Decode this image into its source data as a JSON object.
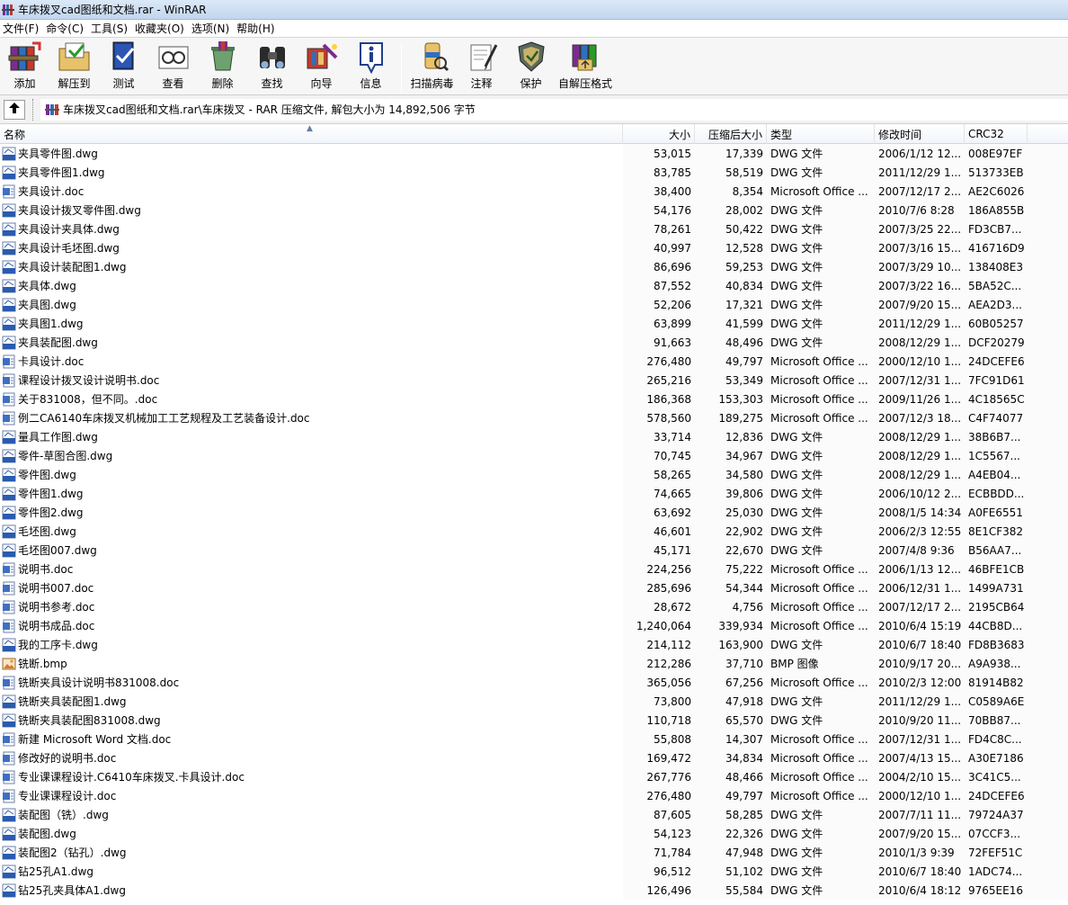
{
  "window": {
    "title": "车床拨叉cad图纸和文档.rar - WinRAR"
  },
  "menu": [
    "文件(F)",
    "命令(C)",
    "工具(S)",
    "收藏夹(O)",
    "选项(N)",
    "帮助(H)"
  ],
  "toolbar": {
    "group1": [
      {
        "label": "添加",
        "icon": "add-books-icon"
      },
      {
        "label": "解压到",
        "icon": "extract-folder-icon"
      },
      {
        "label": "测试",
        "icon": "test-book-icon"
      },
      {
        "label": "查看",
        "icon": "view-glasses-icon"
      },
      {
        "label": "删除",
        "icon": "delete-bin-icon"
      },
      {
        "label": "查找",
        "icon": "find-binoculars-icon"
      },
      {
        "label": "向导",
        "icon": "wizard-icon"
      },
      {
        "label": "信息",
        "icon": "info-icon"
      }
    ],
    "group2": [
      {
        "label": "扫描病毒",
        "icon": "virus-scan-icon"
      },
      {
        "label": "注释",
        "icon": "comment-icon"
      },
      {
        "label": "保护",
        "icon": "protect-shield-icon"
      },
      {
        "label": "自解压格式",
        "icon": "sfx-archive-icon"
      }
    ]
  },
  "address": {
    "path": "车床拨叉cad图纸和文档.rar\\车床拨叉 - RAR 压缩文件, 解包大小为 14,892,506 字节"
  },
  "columns": {
    "name": "名称",
    "size": "大小",
    "packed": "压缩后大小",
    "type": "类型",
    "modified": "修改时间",
    "crc": "CRC32"
  },
  "colors": {
    "dwg_icon": "#2a5bb0",
    "doc_icon": "#3f6fc2",
    "bmp_icon": "#d9782a",
    "titlebar": "#c2d6ee"
  },
  "files": [
    {
      "name": "夹具零件图.dwg",
      "kind": "dwg",
      "size": "53,015",
      "packed": "17,339",
      "type": "DWG 文件",
      "modified": "2006/1/12 12...",
      "crc": "008E97EF"
    },
    {
      "name": "夹具零件图1.dwg",
      "kind": "dwg",
      "size": "83,785",
      "packed": "58,519",
      "type": "DWG 文件",
      "modified": "2011/12/29 1...",
      "crc": "513733EB"
    },
    {
      "name": "夹具设计.doc",
      "kind": "doc",
      "size": "38,400",
      "packed": "8,354",
      "type": "Microsoft Office ...",
      "modified": "2007/12/17 2...",
      "crc": "AE2C6026"
    },
    {
      "name": "夹具设计拨叉零件图.dwg",
      "kind": "dwg",
      "size": "54,176",
      "packed": "28,002",
      "type": "DWG 文件",
      "modified": "2010/7/6 8:28",
      "crc": "186A855B"
    },
    {
      "name": "夹具设计夹具体.dwg",
      "kind": "dwg",
      "size": "78,261",
      "packed": "50,422",
      "type": "DWG 文件",
      "modified": "2007/3/25 22...",
      "crc": "FD3CB7..."
    },
    {
      "name": "夹具设计毛坯图.dwg",
      "kind": "dwg",
      "size": "40,997",
      "packed": "12,528",
      "type": "DWG 文件",
      "modified": "2007/3/16 15...",
      "crc": "416716D9"
    },
    {
      "name": "夹具设计装配图1.dwg",
      "kind": "dwg",
      "size": "86,696",
      "packed": "59,253",
      "type": "DWG 文件",
      "modified": "2007/3/29 10...",
      "crc": "138408E3"
    },
    {
      "name": "夹具体.dwg",
      "kind": "dwg",
      "size": "87,552",
      "packed": "40,834",
      "type": "DWG 文件",
      "modified": "2007/3/22 16...",
      "crc": "5BA52C..."
    },
    {
      "name": "夹具图.dwg",
      "kind": "dwg",
      "size": "52,206",
      "packed": "17,321",
      "type": "DWG 文件",
      "modified": "2007/9/20 15...",
      "crc": "AEA2D3..."
    },
    {
      "name": "夹具图1.dwg",
      "kind": "dwg",
      "size": "63,899",
      "packed": "41,599",
      "type": "DWG 文件",
      "modified": "2011/12/29 1...",
      "crc": "60B05257"
    },
    {
      "name": "夹具装配图.dwg",
      "kind": "dwg",
      "size": "91,663",
      "packed": "48,496",
      "type": "DWG 文件",
      "modified": "2008/12/29 1...",
      "crc": "DCF20279"
    },
    {
      "name": "卡具设计.doc",
      "kind": "doc",
      "size": "276,480",
      "packed": "49,797",
      "type": "Microsoft Office ...",
      "modified": "2000/12/10 1...",
      "crc": "24DCEFE6"
    },
    {
      "name": "课程设计拨叉设计说明书.doc",
      "kind": "doc",
      "size": "265,216",
      "packed": "53,349",
      "type": "Microsoft Office ...",
      "modified": "2007/12/31 1...",
      "crc": "7FC91D61"
    },
    {
      "name": "关于831008，但不同。.doc",
      "kind": "doc",
      "size": "186,368",
      "packed": "153,303",
      "type": "Microsoft Office ...",
      "modified": "2009/11/26 1...",
      "crc": "4C18565C"
    },
    {
      "name": "例二CA6140车床拨叉机械加工工艺规程及工艺装备设计.doc",
      "kind": "doc",
      "size": "578,560",
      "packed": "189,275",
      "type": "Microsoft Office ...",
      "modified": "2007/12/3 18...",
      "crc": "C4F74077"
    },
    {
      "name": "量具工作图.dwg",
      "kind": "dwg",
      "size": "33,714",
      "packed": "12,836",
      "type": "DWG 文件",
      "modified": "2008/12/29 1...",
      "crc": "38B6B7..."
    },
    {
      "name": "零件-草图合图.dwg",
      "kind": "dwg",
      "size": "70,745",
      "packed": "34,967",
      "type": "DWG 文件",
      "modified": "2008/12/29 1...",
      "crc": "1C5567..."
    },
    {
      "name": "零件图.dwg",
      "kind": "dwg",
      "size": "58,265",
      "packed": "34,580",
      "type": "DWG 文件",
      "modified": "2008/12/29 1...",
      "crc": "A4EB04..."
    },
    {
      "name": "零件图1.dwg",
      "kind": "dwg",
      "size": "74,665",
      "packed": "39,806",
      "type": "DWG 文件",
      "modified": "2006/10/12 2...",
      "crc": "ECBBDD..."
    },
    {
      "name": "零件图2.dwg",
      "kind": "dwg",
      "size": "63,692",
      "packed": "25,030",
      "type": "DWG 文件",
      "modified": "2008/1/5 14:34",
      "crc": "A0FE6551"
    },
    {
      "name": "毛坯图.dwg",
      "kind": "dwg",
      "size": "46,601",
      "packed": "22,902",
      "type": "DWG 文件",
      "modified": "2006/2/3 12:55",
      "crc": "8E1CF382"
    },
    {
      "name": "毛坯图007.dwg",
      "kind": "dwg",
      "size": "45,171",
      "packed": "22,670",
      "type": "DWG 文件",
      "modified": "2007/4/8 9:36",
      "crc": "B56AA7..."
    },
    {
      "name": "说明书.doc",
      "kind": "doc",
      "size": "224,256",
      "packed": "75,222",
      "type": "Microsoft Office ...",
      "modified": "2006/1/13 12...",
      "crc": "46BFE1CB"
    },
    {
      "name": "说明书007.doc",
      "kind": "doc",
      "size": "285,696",
      "packed": "54,344",
      "type": "Microsoft Office ...",
      "modified": "2006/12/31 1...",
      "crc": "1499A731"
    },
    {
      "name": "说明书参考.doc",
      "kind": "doc",
      "size": "28,672",
      "packed": "4,756",
      "type": "Microsoft Office ...",
      "modified": "2007/12/17 2...",
      "crc": "2195CB64"
    },
    {
      "name": "说明书成品.doc",
      "kind": "doc",
      "size": "1,240,064",
      "packed": "339,934",
      "type": "Microsoft Office ...",
      "modified": "2010/6/4 15:19",
      "crc": "44CB8D..."
    },
    {
      "name": "我的工序卡.dwg",
      "kind": "dwg",
      "size": "214,112",
      "packed": "163,900",
      "type": "DWG 文件",
      "modified": "2010/6/7 18:40",
      "crc": "FD8B3683"
    },
    {
      "name": "铣断.bmp",
      "kind": "bmp",
      "size": "212,286",
      "packed": "37,710",
      "type": "BMP 图像",
      "modified": "2010/9/17 20...",
      "crc": "A9A938..."
    },
    {
      "name": "铣断夹具设计说明书831008.doc",
      "kind": "doc",
      "size": "365,056",
      "packed": "67,256",
      "type": "Microsoft Office ...",
      "modified": "2010/2/3 12:00",
      "crc": "81914B82"
    },
    {
      "name": "铣断夹具装配图1.dwg",
      "kind": "dwg",
      "size": "73,800",
      "packed": "47,918",
      "type": "DWG 文件",
      "modified": "2011/12/29 1...",
      "crc": "C0589A6E"
    },
    {
      "name": "铣断夹具装配图831008.dwg",
      "kind": "dwg",
      "size": "110,718",
      "packed": "65,570",
      "type": "DWG 文件",
      "modified": "2010/9/20 11...",
      "crc": "70BB87..."
    },
    {
      "name": "新建 Microsoft Word 文档.doc",
      "kind": "doc",
      "size": "55,808",
      "packed": "14,307",
      "type": "Microsoft Office ...",
      "modified": "2007/12/31 1...",
      "crc": "FD4C8C..."
    },
    {
      "name": "修改好的说明书.doc",
      "kind": "doc",
      "size": "169,472",
      "packed": "34,834",
      "type": "Microsoft Office ...",
      "modified": "2007/4/13 15...",
      "crc": "A30E7186"
    },
    {
      "name": "专业课课程设计.C6410车床拨叉.卡具设计.doc",
      "kind": "doc",
      "size": "267,776",
      "packed": "48,466",
      "type": "Microsoft Office ...",
      "modified": "2004/2/10 15...",
      "crc": "3C41C5..."
    },
    {
      "name": "专业课课程设计.doc",
      "kind": "doc",
      "size": "276,480",
      "packed": "49,797",
      "type": "Microsoft Office ...",
      "modified": "2000/12/10 1...",
      "crc": "24DCEFE6"
    },
    {
      "name": "装配图（铣）.dwg",
      "kind": "dwg",
      "size": "87,605",
      "packed": "58,285",
      "type": "DWG 文件",
      "modified": "2007/7/11 11...",
      "crc": "79724A37"
    },
    {
      "name": "装配图.dwg",
      "kind": "dwg",
      "size": "54,123",
      "packed": "22,326",
      "type": "DWG 文件",
      "modified": "2007/9/20 15...",
      "crc": "07CCF3..."
    },
    {
      "name": "装配图2（钻孔）.dwg",
      "kind": "dwg",
      "size": "71,784",
      "packed": "47,948",
      "type": "DWG 文件",
      "modified": "2010/1/3 9:39",
      "crc": "72FEF51C"
    },
    {
      "name": "钻25孔A1.dwg",
      "kind": "dwg",
      "size": "96,512",
      "packed": "51,102",
      "type": "DWG 文件",
      "modified": "2010/6/7 18:40",
      "crc": "1ADC74..."
    },
    {
      "name": "钻25孔夹具体A1.dwg",
      "kind": "dwg",
      "size": "126,496",
      "packed": "55,584",
      "type": "DWG 文件",
      "modified": "2010/6/4 18:12",
      "crc": "9765EE16"
    }
  ]
}
